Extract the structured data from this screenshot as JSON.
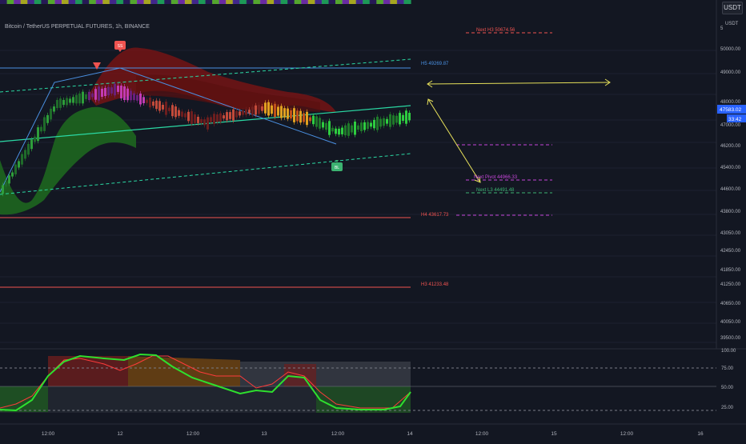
{
  "header": {
    "symbol_title": "Bitcoin / TetherUS PERPETUAL FUTURES, 1h, BINANCE",
    "currency_button": "USDT",
    "currency_label": "USDT"
  },
  "price_axis": {
    "ticks": [
      "50000.00",
      "49000.00",
      "48000.00",
      "47000.00",
      "46200.00",
      "45400.00",
      "44600.00",
      "43800.00",
      "43050.00",
      "42450.00",
      "41850.00",
      "41250.00",
      "40650.00",
      "40050.00",
      "39500.00"
    ],
    "current_price": "47583.02",
    "countdown": "33:42",
    "top_partial": "5"
  },
  "osc_axis": {
    "ticks": [
      "100.00",
      "75.00",
      "50.00",
      "25.00"
    ]
  },
  "time_axis": {
    "labels": [
      "12:00",
      "12",
      "12:00",
      "13",
      "12:00",
      "14",
      "12:00",
      "15",
      "12:00",
      "16"
    ]
  },
  "levels": {
    "h5": "H5 49269.87",
    "h4": "H4 43617.73",
    "h3": "H3 41233.48",
    "next_h3": "Next H3 50674.56",
    "next_pivot": "Next Pivot 44966.33",
    "next_l3": "Next L3 44491.48"
  },
  "markers": {
    "sell_tag": "SS",
    "buy_tag": "BL"
  },
  "colors": {
    "background": "#131722",
    "up": "#26a69a",
    "down": "#ef5350",
    "resistance": "#f05350",
    "h5_line": "#4a90e2",
    "channel": "#2bd9a4",
    "pivot_lines": "#c646d9",
    "arrow": "#e6e05a",
    "osc_green": "#2ee02e",
    "osc_red": "#ff3b3b"
  },
  "icons": [
    "sell-signal-triangle-icon",
    "sell-label-icon",
    "buy-label-icon",
    "double-arrow-icon",
    "diagonal-arrow-icon"
  ]
}
